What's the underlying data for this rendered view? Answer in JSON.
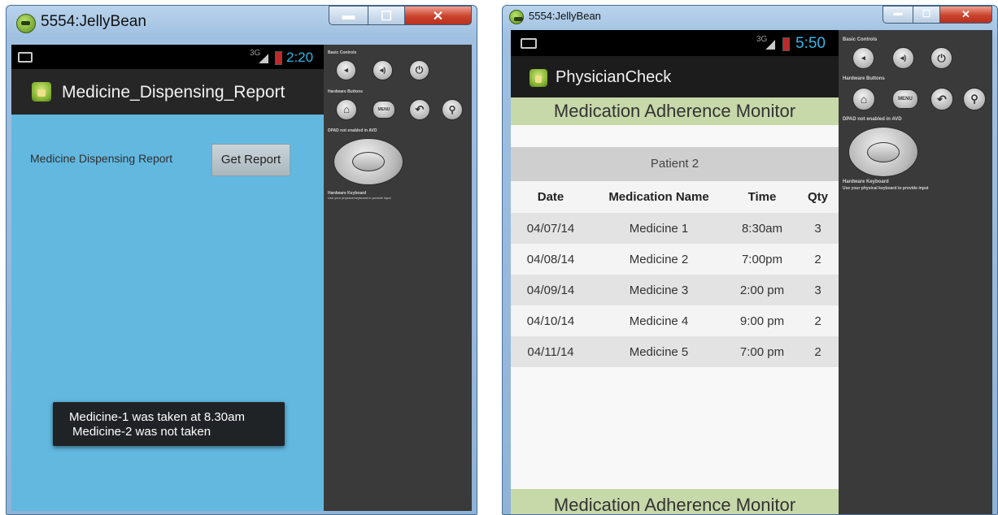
{
  "left_window": {
    "title": "5554:JellyBean",
    "status_bar": {
      "network": "3G",
      "time": "2:20"
    },
    "app_title": "Medicine_Dispensing_Report",
    "report_label": "Medicine Dispensing Report",
    "get_report_button": "Get Report",
    "toast_lines": [
      "Medicine-1 was taken at 8.30am",
      "Medicine-2 was not taken"
    ],
    "side_panel": {
      "basic_controls": "Basic Controls",
      "hardware_buttons": "Hardware Buttons",
      "dpad": "DPAD not enabled in AVD",
      "hardware_keyboard": "Hardware Keyboard",
      "keyboard_hint": "Use your physical keyboard to provide input",
      "menu_label": "MENU"
    }
  },
  "right_window": {
    "title": "5554:JellyBean",
    "status_bar": {
      "network": "3G",
      "time": "5:50"
    },
    "app_title": "PhysicianCheck",
    "banner_top": "Medication Adherence Monitor",
    "banner_bottom": "Medication Adherence Monitor",
    "patient": "Patient 2",
    "table": {
      "headers": [
        "Date",
        "Medication Name",
        "Time",
        "Qty"
      ],
      "rows": [
        [
          "04/07/14",
          "Medicine 1",
          "8:30am",
          "3"
        ],
        [
          "04/08/14",
          "Medicine 2",
          "7:00pm",
          "2"
        ],
        [
          "04/09/14",
          "Medicine 3",
          "2:00 pm",
          "3"
        ],
        [
          "04/10/14",
          "Medicine 4",
          "9:00 pm",
          "2"
        ],
        [
          "04/11/14",
          "Medicine 5",
          "7:00 pm",
          "2"
        ]
      ]
    },
    "side_panel": {
      "basic_controls": "Basic Controls",
      "hardware_buttons": "Hardware Buttons",
      "dpad": "DPAD not enabled in AVD",
      "hardware_keyboard": "Hardware Keyboard",
      "keyboard_hint": "Use your physical keyboard to provide input",
      "menu_label": "MENU"
    }
  },
  "colors": {
    "left_content_bg": "#63b8e0",
    "banner_bg": "#c7d8a9",
    "clock": "#33b5e5",
    "row_shade": "#e3e3e3"
  }
}
